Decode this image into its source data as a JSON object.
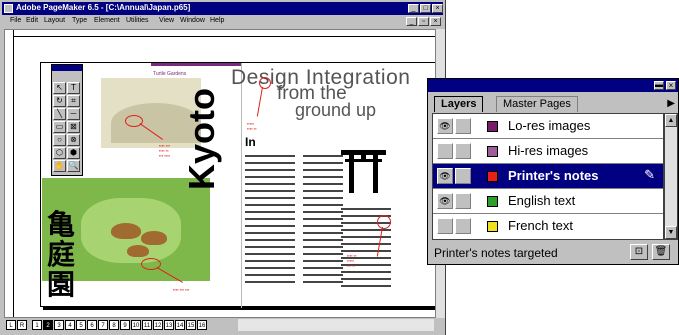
{
  "window": {
    "title": "Adobe PageMaker 6.5 - [C:\\Annual\\Japan.p65]",
    "controls": [
      "_",
      "□",
      "×"
    ]
  },
  "menubar": [
    "File",
    "Edit",
    "Layout",
    "Type",
    "Element",
    "Utilities",
    "View",
    "Window",
    "Help"
  ],
  "document": {
    "headline_lines": [
      "Design Integration",
      "from the",
      "ground up"
    ],
    "vertical_title": "Kyoto",
    "kanji": [
      "亀",
      "庭",
      "園"
    ],
    "caption_title": "Turtle Gardens",
    "drop_cap": "In",
    "accent_color": "#7a2a80",
    "note_color": "#e0201a"
  },
  "page_numbers": [
    "L",
    "R",
    "1",
    "2",
    "3",
    "4",
    "5",
    "6",
    "7",
    "8",
    "9",
    "10",
    "11",
    "12",
    "13",
    "14",
    "15",
    "16"
  ],
  "active_page": "2",
  "layers_palette": {
    "tabs": [
      "Layers",
      "Master Pages"
    ],
    "active_tab": "Layers",
    "layers": [
      {
        "name": "Lo-res images",
        "color": "#7a1a6a",
        "visible": true,
        "selected": false
      },
      {
        "name": "Hi-res images",
        "color": "#a05c9a",
        "visible": false,
        "selected": false
      },
      {
        "name": "Printer's notes",
        "color": "#e8201a",
        "visible": true,
        "selected": true
      },
      {
        "name": "English text",
        "color": "#2ea02a",
        "visible": true,
        "selected": false
      },
      {
        "name": "French text",
        "color": "#f0e020",
        "visible": false,
        "selected": false
      }
    ],
    "status": "Printer's notes targeted",
    "eye_icon": "👁",
    "pen_icon": "✎",
    "new_layer_icon": "⊡",
    "trash_icon": "🗑"
  }
}
